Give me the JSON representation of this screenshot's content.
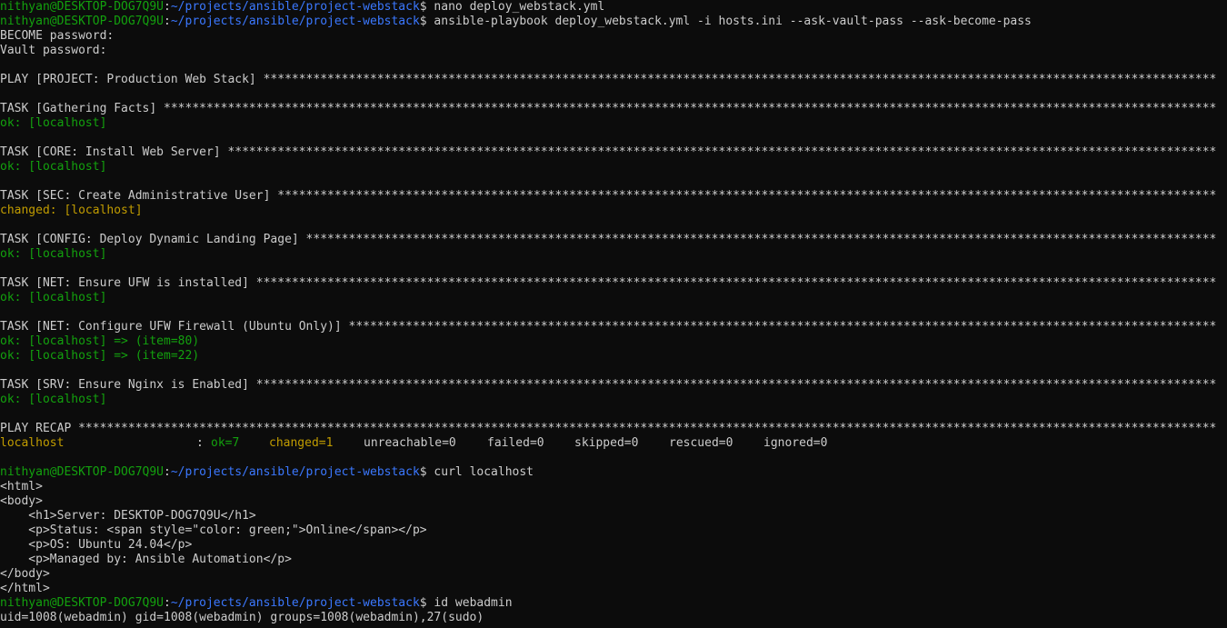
{
  "colors": {
    "background": "#0c0c0c",
    "text": "#cccccc",
    "prompt_user": "#13a10e",
    "prompt_path": "#3b78ff",
    "ok": "#13a10e",
    "changed": "#c19c00"
  },
  "prompt": {
    "user_host": "nithyan@DESKTOP-DOG7Q9U",
    "colon": ":",
    "path": "~/projects/ansible/project-webstack",
    "symbol": "$"
  },
  "commands": {
    "nano": " nano deploy_webstack.yml",
    "playbook": " ansible-playbook deploy_webstack.yml -i hosts.ini --ask-vault-pass --ask-become-pass",
    "curl": " curl localhost",
    "id": " id webadmin"
  },
  "password_prompts": {
    "become": "BECOME password:",
    "vault": "Vault password:"
  },
  "play_header": "PLAY [PROJECT: Production Web Stack] ",
  "tasks": [
    {
      "header": "TASK [Gathering Facts] ",
      "results": [
        {
          "status": "ok",
          "text": "ok: [localhost]"
        }
      ]
    },
    {
      "header": "TASK [CORE: Install Web Server] ",
      "results": [
        {
          "status": "ok",
          "text": "ok: [localhost]"
        }
      ]
    },
    {
      "header": "TASK [SEC: Create Administrative User] ",
      "results": [
        {
          "status": "changed",
          "text": "changed: [localhost]"
        }
      ]
    },
    {
      "header": "TASK [CONFIG: Deploy Dynamic Landing Page] ",
      "results": [
        {
          "status": "ok",
          "text": "ok: [localhost]"
        }
      ]
    },
    {
      "header": "TASK [NET: Ensure UFW is installed] ",
      "results": [
        {
          "status": "ok",
          "text": "ok: [localhost]"
        }
      ]
    },
    {
      "header": "TASK [NET: Configure UFW Firewall (Ubuntu Only)] ",
      "results": [
        {
          "status": "ok",
          "text": "ok: [localhost] => (item=80)"
        },
        {
          "status": "ok",
          "text": "ok: [localhost] => (item=22)"
        }
      ]
    },
    {
      "header": "TASK [SRV: Ensure Nginx is Enabled] ",
      "results": [
        {
          "status": "ok",
          "text": "ok: [localhost]"
        }
      ]
    }
  ],
  "recap": {
    "header": "PLAY RECAP ",
    "host": "localhost",
    "colon": ":",
    "ok": "ok=7",
    "changed": "changed=1",
    "unreachable": "unreachable=0",
    "failed": "failed=0",
    "skipped": "skipped=0",
    "rescued": "rescued=0",
    "ignored": "ignored=0"
  },
  "curl_output": [
    "<html>",
    "<body>",
    "    <h1>Server: DESKTOP-DOG7Q9U</h1>",
    "    <p>Status: <span style=\"color: green;\">Online</span></p>",
    "    <p>OS: Ubuntu 24.04</p>",
    "    <p>Managed by: Ansible Automation</p>",
    "</body>",
    "</html>"
  ],
  "id_output": "uid=1008(webadmin) gid=1008(webadmin) groups=1008(webadmin),27(sudo)"
}
